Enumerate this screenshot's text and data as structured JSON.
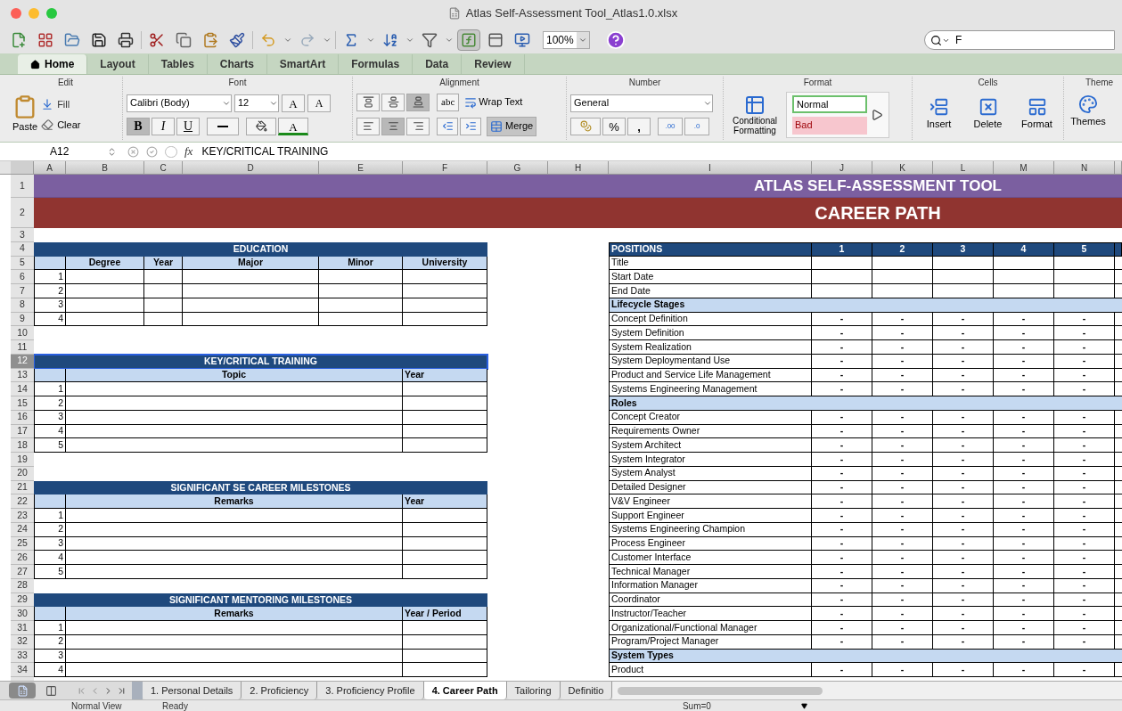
{
  "window": {
    "title": "Atlas Self-Assessment Tool_Atlas1.0.xlsx"
  },
  "toolbar": {
    "formula_builder_active": true,
    "zoom": "100%",
    "search": "F"
  },
  "ribbon_tabs": [
    {
      "label": "Home",
      "selected": true
    },
    {
      "label": "Layout",
      "selected": false
    },
    {
      "label": "Tables",
      "selected": false
    },
    {
      "label": "Charts",
      "selected": false
    },
    {
      "label": "SmartArt",
      "selected": false
    },
    {
      "label": "Formulas",
      "selected": false
    },
    {
      "label": "Data",
      "selected": false
    },
    {
      "label": "Review",
      "selected": false
    }
  ],
  "edit": {
    "label": "Edit",
    "paste": "Paste",
    "fill": "Fill",
    "clear": "Clear"
  },
  "font": {
    "label": "Font",
    "name": "Calibri (Body)",
    "size": "12",
    "grow": "A",
    "shrink": "A",
    "bold": {
      "label": "B",
      "selected": true
    },
    "italic": {
      "label": "I",
      "selected": false
    },
    "underline": {
      "label": "U",
      "selected": false
    },
    "text_color_button": "A"
  },
  "alignment": {
    "label": "Alignment",
    "vertical": [
      {
        "selected": false
      },
      {
        "selected": false
      },
      {
        "selected": true
      }
    ],
    "horizontal": [
      {
        "selected": false
      },
      {
        "selected": true
      },
      {
        "selected": false
      }
    ],
    "orientation": "abc",
    "wrap": "Wrap Text",
    "merge": {
      "label": "Merge",
      "selected": true
    }
  },
  "number": {
    "label": "Number",
    "format": "General",
    "percent": "%",
    "comma": ",",
    "increase": ".00",
    "decrease": ".0"
  },
  "format": {
    "label": "Format",
    "conditional": "Conditional Formatting",
    "styles": [
      {
        "label": "Normal",
        "kind": "normal"
      },
      {
        "label": "Bad",
        "kind": "bad"
      }
    ]
  },
  "cells": {
    "label": "Cells",
    "buttons": [
      "Insert",
      "Delete",
      "Format"
    ]
  },
  "themes": {
    "label": "Theme",
    "button": "Themes"
  },
  "formula_bar": {
    "cell": "A12",
    "fx": "fx",
    "content": "KEY/CRITICAL TRAINING"
  },
  "columns": [
    "A",
    "B",
    "C",
    "D",
    "E",
    "F",
    "G",
    "H",
    "I",
    "J",
    "K",
    "L",
    "M",
    "N"
  ],
  "row_headers": [
    {
      "label": "1",
      "selected": false
    },
    {
      "label": "2",
      "selected": false
    },
    {
      "label": "3",
      "selected": false
    },
    {
      "label": "4",
      "selected": false
    },
    {
      "label": "5",
      "selected": false
    },
    {
      "label": "6",
      "selected": false
    },
    {
      "label": "7",
      "selected": false
    },
    {
      "label": "8",
      "selected": false
    },
    {
      "label": "9",
      "selected": false
    },
    {
      "label": "10",
      "selected": false
    },
    {
      "label": "11",
      "selected": false
    },
    {
      "label": "12",
      "selected": true
    },
    {
      "label": "13",
      "selected": false
    },
    {
      "label": "14",
      "selected": false
    },
    {
      "label": "15",
      "selected": false
    },
    {
      "label": "16",
      "selected": false
    },
    {
      "label": "17",
      "selected": false
    },
    {
      "label": "18",
      "selected": false
    },
    {
      "label": "19",
      "selected": false
    },
    {
      "label": "20",
      "selected": false
    },
    {
      "label": "21",
      "selected": false
    },
    {
      "label": "22",
      "selected": false
    },
    {
      "label": "23",
      "selected": false
    },
    {
      "label": "24",
      "selected": false
    },
    {
      "label": "25",
      "selected": false
    },
    {
      "label": "26",
      "selected": false
    },
    {
      "label": "27",
      "selected": false
    },
    {
      "label": "28",
      "selected": false
    },
    {
      "label": "29",
      "selected": false
    },
    {
      "label": "30",
      "selected": false
    },
    {
      "label": "31",
      "selected": false
    },
    {
      "label": "32",
      "selected": false
    },
    {
      "label": "33",
      "selected": false
    },
    {
      "label": "34",
      "selected": false
    }
  ],
  "banner": {
    "title": "ATLAS SELF-ASSESSMENT TOOL",
    "subtitle": "CAREER PATH"
  },
  "left_tables": [
    {
      "title": "EDUCATION",
      "selected": false,
      "columns": [
        "",
        "Degree",
        "Year",
        "Major",
        "Minor",
        "University"
      ],
      "rows": [
        "1",
        "2",
        "3",
        "4"
      ]
    },
    {
      "title": "KEY/CRITICAL TRAINING",
      "selected": true,
      "columns": [
        "",
        "Topic",
        "Year"
      ],
      "rows": [
        "1",
        "2",
        "3",
        "4",
        "5"
      ]
    },
    {
      "title": "SIGNIFICANT SE CAREER MILESTONES",
      "selected": false,
      "columns": [
        "",
        "Remarks",
        "Year"
      ],
      "rows": [
        "1",
        "2",
        "3",
        "4",
        "5"
      ]
    },
    {
      "title": "SIGNIFICANT MENTORING MILESTONES",
      "selected": false,
      "columns": [
        "",
        "Remarks",
        "Year / Period"
      ],
      "rows": [
        "1",
        "2",
        "3",
        "4"
      ]
    }
  ],
  "positions": {
    "header": "POSITIONS",
    "columns": [
      "1",
      "2",
      "3",
      "4",
      "5"
    ],
    "rows": [
      {
        "kind": "field",
        "label": "Title"
      },
      {
        "kind": "field",
        "label": "Start Date"
      },
      {
        "kind": "field",
        "label": "End Date"
      },
      {
        "kind": "section",
        "label": "Lifecycle Stages"
      },
      {
        "kind": "item",
        "label": "Concept Definition",
        "values": [
          "-",
          "-",
          "-",
          "-",
          "-"
        ]
      },
      {
        "kind": "item",
        "label": "System Definition",
        "values": [
          "-",
          "-",
          "-",
          "-",
          "-"
        ]
      },
      {
        "kind": "item",
        "label": "System Realization",
        "values": [
          "-",
          "-",
          "-",
          "-",
          "-"
        ]
      },
      {
        "kind": "item",
        "label": "System Deploymentand Use",
        "values": [
          "-",
          "-",
          "-",
          "-",
          "-"
        ]
      },
      {
        "kind": "item",
        "label": "Product and Service Life Management",
        "values": [
          "-",
          "-",
          "-",
          "-",
          "-"
        ]
      },
      {
        "kind": "item",
        "label": "Systems Engineering Management",
        "values": [
          "-",
          "-",
          "-",
          "-",
          "-"
        ]
      },
      {
        "kind": "section",
        "label": "Roles"
      },
      {
        "kind": "item",
        "label": "Concept Creator",
        "values": [
          "-",
          "-",
          "-",
          "-",
          "-"
        ]
      },
      {
        "kind": "item",
        "label": "Requirements Owner",
        "values": [
          "-",
          "-",
          "-",
          "-",
          "-"
        ]
      },
      {
        "kind": "item",
        "label": "System Architect",
        "values": [
          "-",
          "-",
          "-",
          "-",
          "-"
        ]
      },
      {
        "kind": "item",
        "label": "System Integrator",
        "values": [
          "-",
          "-",
          "-",
          "-",
          "-"
        ]
      },
      {
        "kind": "item",
        "label": "System Analyst",
        "values": [
          "-",
          "-",
          "-",
          "-",
          "-"
        ]
      },
      {
        "kind": "item",
        "label": "Detailed Designer",
        "values": [
          "-",
          "-",
          "-",
          "-",
          "-"
        ]
      },
      {
        "kind": "item",
        "label": "V&V Engineer",
        "values": [
          "-",
          "-",
          "-",
          "-",
          "-"
        ]
      },
      {
        "kind": "item",
        "label": "Support Engineer",
        "values": [
          "-",
          "-",
          "-",
          "-",
          "-"
        ]
      },
      {
        "kind": "item",
        "label": "Systems Engineering Champion",
        "values": [
          "-",
          "-",
          "-",
          "-",
          "-"
        ]
      },
      {
        "kind": "item",
        "label": "Process Engineer",
        "values": [
          "-",
          "-",
          "-",
          "-",
          "-"
        ]
      },
      {
        "kind": "item",
        "label": "Customer Interface",
        "values": [
          "-",
          "-",
          "-",
          "-",
          "-"
        ]
      },
      {
        "kind": "item",
        "label": "Technical Manager",
        "values": [
          "-",
          "-",
          "-",
          "-",
          "-"
        ]
      },
      {
        "kind": "item",
        "label": "Information Manager",
        "values": [
          "-",
          "-",
          "-",
          "-",
          "-"
        ]
      },
      {
        "kind": "item",
        "label": "Coordinator",
        "values": [
          "-",
          "-",
          "-",
          "-",
          "-"
        ]
      },
      {
        "kind": "item",
        "label": "Instructor/Teacher",
        "values": [
          "-",
          "-",
          "-",
          "-",
          "-"
        ]
      },
      {
        "kind": "item",
        "label": "Organizational/Functional Manager",
        "values": [
          "-",
          "-",
          "-",
          "-",
          "-"
        ]
      },
      {
        "kind": "item",
        "label": "Program/Project Manager",
        "values": [
          "-",
          "-",
          "-",
          "-",
          "-"
        ]
      },
      {
        "kind": "section",
        "label": "System Types"
      },
      {
        "kind": "item",
        "label": "Product",
        "values": [
          "-",
          "-",
          "-",
          "-",
          "-"
        ]
      }
    ]
  },
  "sheet_tabs": [
    {
      "label": "1. Personal Details",
      "selected": false
    },
    {
      "label": "2. Proficiency",
      "selected": false
    },
    {
      "label": "3. Proficiency Profile",
      "selected": false
    },
    {
      "label": "4. Career Path",
      "selected": true
    },
    {
      "label": "Tailoring",
      "selected": false
    },
    {
      "label": "Definitio",
      "selected": false
    }
  ],
  "status": {
    "view": "Normal View",
    "state": "Ready",
    "sum": "Sum=0"
  }
}
